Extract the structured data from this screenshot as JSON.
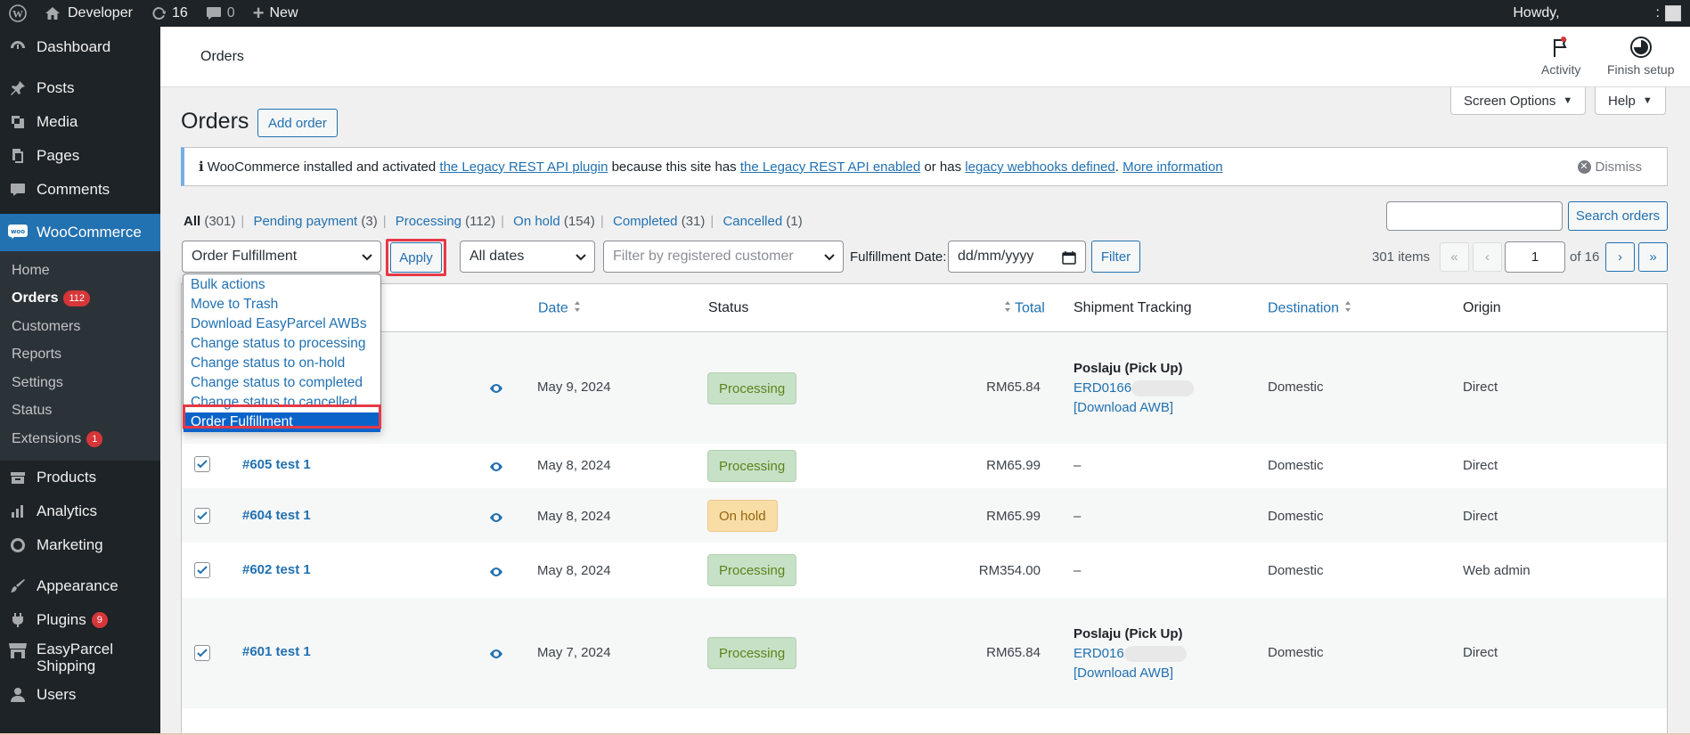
{
  "adminbar": {
    "site_name": "Developer",
    "updates_count": "16",
    "comments_count": "0",
    "new_label": "New",
    "howdy": "Howdy,",
    "howdy_tail": ":"
  },
  "sidebar": {
    "top_items": [
      {
        "label": "Dashboard",
        "icon": "dashboard-icon"
      },
      {
        "label": "Posts",
        "icon": "pin-icon"
      },
      {
        "label": "Media",
        "icon": "media-icon"
      },
      {
        "label": "Pages",
        "icon": "pages-icon"
      },
      {
        "label": "Comments",
        "icon": "comment-icon"
      }
    ],
    "woocommerce": "WooCommerce",
    "woo_sub": [
      {
        "label": "Home"
      },
      {
        "label": "Orders",
        "badge": "112"
      },
      {
        "label": "Customers"
      },
      {
        "label": "Reports"
      },
      {
        "label": "Settings"
      },
      {
        "label": "Status"
      },
      {
        "label": "Extensions",
        "badge": "1"
      }
    ],
    "bottom_items": [
      {
        "label": "Products"
      },
      {
        "label": "Analytics"
      },
      {
        "label": "Marketing"
      },
      {
        "label": "Appearance"
      },
      {
        "label": "Plugins",
        "badge": "9"
      },
      {
        "label": "EasyParcel Shipping"
      },
      {
        "label": "Users"
      }
    ]
  },
  "header": {
    "breadcrumb": "Orders",
    "activity": "Activity",
    "finish_setup": "Finish setup"
  },
  "screen_options": "Screen Options",
  "help": "Help",
  "page": {
    "title": "Orders",
    "add_order": "Add order"
  },
  "notice": {
    "prefix": "WooCommerce installed and activated",
    "link1": "the Legacy REST API plugin",
    "mid1": "because this site has",
    "link2": "the Legacy REST API enabled",
    "mid2": "or has",
    "link3": "legacy webhooks defined",
    "link4": "More information",
    "dismiss": "Dismiss"
  },
  "status_links": [
    {
      "label": "All",
      "count": "(301)",
      "current": true
    },
    {
      "label": "Pending payment",
      "count": "(3)"
    },
    {
      "label": "Processing",
      "count": "(112)"
    },
    {
      "label": "On hold",
      "count": "(154)"
    },
    {
      "label": "Completed",
      "count": "(31)"
    },
    {
      "label": "Cancelled",
      "count": "(1)"
    }
  ],
  "search": {
    "button": "Search orders",
    "value": ""
  },
  "tablenav": {
    "bulk_selected": "Order Fulfillment",
    "apply": "Apply",
    "dates": "All dates",
    "customer_placeholder": "Filter by registered customer",
    "fulfillment_label": "Fulfillment Date:",
    "date_placeholder": "dd/mm/yyyy",
    "filter": "Filter",
    "items": "301 items",
    "page": "1",
    "of": "of 16",
    "first": "«",
    "prev": "‹",
    "next": "›",
    "last": "»"
  },
  "bulk_options": [
    "Bulk actions",
    "Move to Trash",
    "Download EasyParcel AWBs",
    "Change status to processing",
    "Change status to on-hold",
    "Change status to completed",
    "Change status to cancelled",
    "Order Fulfillment"
  ],
  "columns": {
    "date": "Date",
    "status": "Status",
    "total": "Total",
    "shipment": "Shipment Tracking",
    "destination": "Destination",
    "origin": "Origin"
  },
  "rows": [
    {
      "order": "",
      "date": "May 9, 2024",
      "status": "Processing",
      "total": "RM65.84",
      "carrier": "Poslaju (Pick Up)",
      "tracking": "ERD0166",
      "awb": "[Download AWB]",
      "destination": "Domestic",
      "origin": "Direct"
    },
    {
      "order": "#605 test 1",
      "date": "May 8, 2024",
      "status": "Processing",
      "total": "RM65.99",
      "tracking_dash": "–",
      "destination": "Domestic",
      "origin": "Direct"
    },
    {
      "order": "#604 test 1",
      "date": "May 8, 2024",
      "status": "On hold",
      "total": "RM65.99",
      "tracking_dash": "–",
      "destination": "Domestic",
      "origin": "Direct"
    },
    {
      "order": "#602 test 1",
      "date": "May 8, 2024",
      "status": "Processing",
      "total": "RM354.00",
      "tracking_dash": "–",
      "destination": "Domestic",
      "origin": "Web admin"
    },
    {
      "order": "#601 test 1",
      "date": "May 7, 2024",
      "status": "Processing",
      "total": "RM65.84",
      "carrier": "Poslaju (Pick Up)",
      "tracking": "ERD016",
      "awb": "[Download AWB]",
      "destination": "Domestic",
      "origin": "Direct"
    }
  ],
  "colors": {
    "admin_bg": "#1d2327",
    "accent": "#2271b1",
    "processing_bg": "#c6e1c6",
    "onhold_bg": "#f8dda7",
    "highlight": "#e63946"
  }
}
